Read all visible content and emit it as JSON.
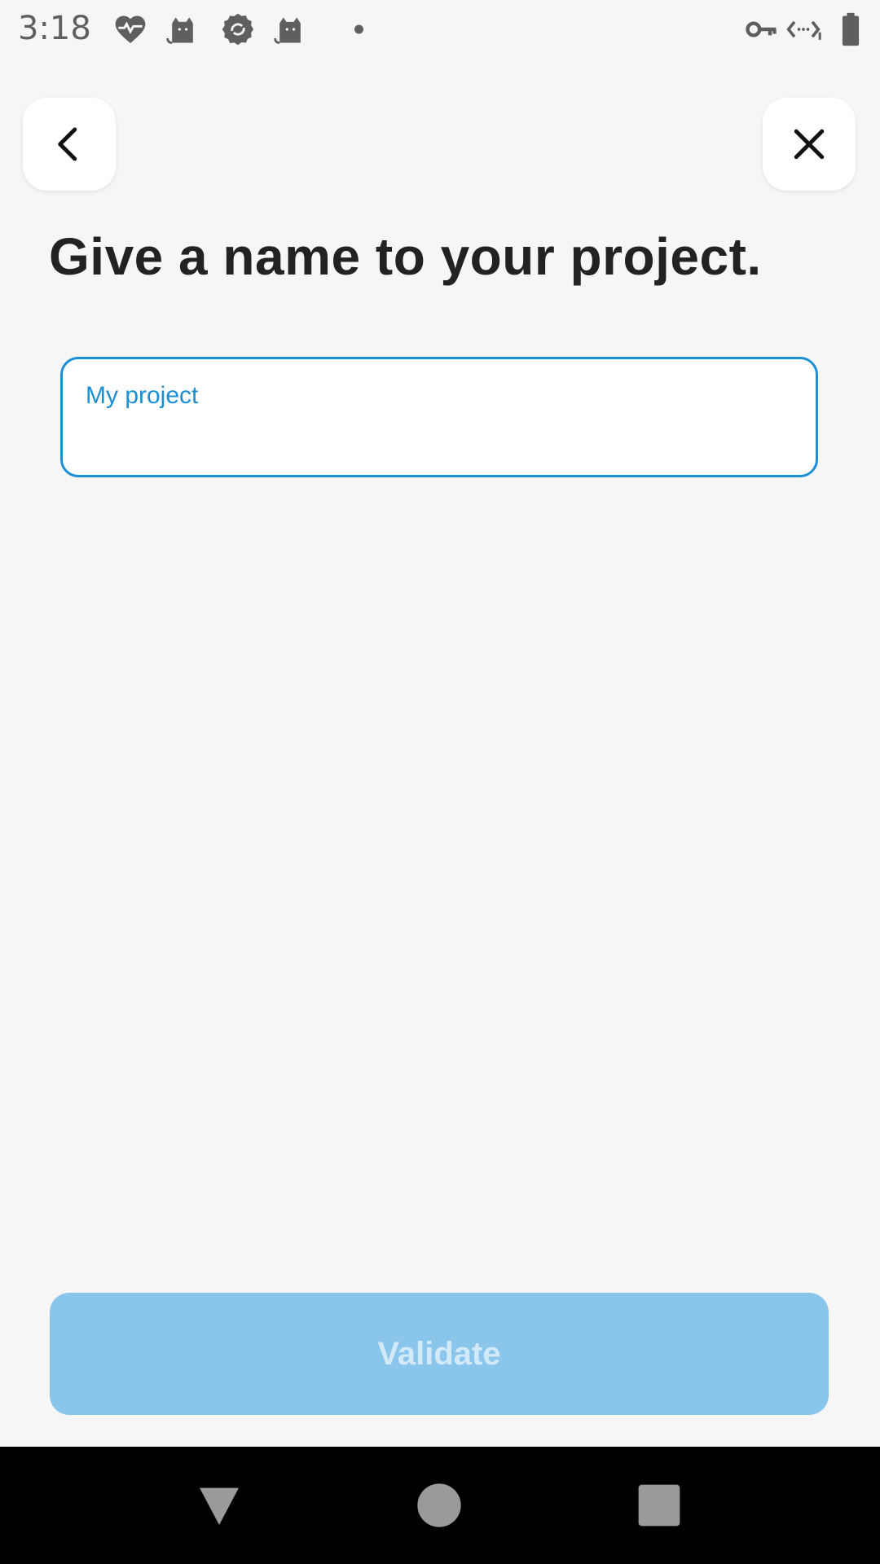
{
  "status_bar": {
    "time": "3:18",
    "left_icons": [
      "heart-pulse-icon",
      "cat-icon",
      "sync-badge-icon",
      "cat-icon",
      "dot-icon"
    ],
    "right_icons": [
      "vpn-key-icon",
      "data-saver-icon",
      "battery-icon"
    ]
  },
  "header": {
    "back_icon": "chevron-left-icon",
    "close_icon": "close-icon"
  },
  "page": {
    "title": "Give a name to your project."
  },
  "name_field": {
    "label": "My project",
    "value": ""
  },
  "footer": {
    "validate_label": "Validate",
    "validate_enabled": false
  },
  "colors": {
    "accent": "#1a8fd6",
    "button_disabled_bg": "#8ac5ec",
    "button_disabled_text": "#d2e9f8",
    "background": "#f6f6f6",
    "title_text": "#222222"
  },
  "nav_bar": {
    "buttons": [
      "back-triangle-icon",
      "home-circle-icon",
      "recents-square-icon"
    ]
  }
}
